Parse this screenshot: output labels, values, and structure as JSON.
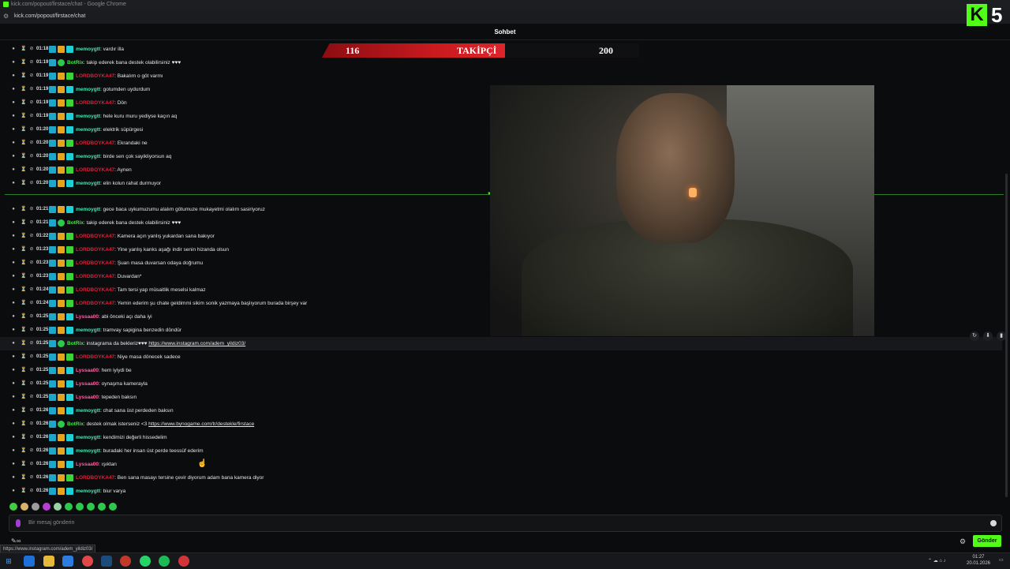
{
  "browser": {
    "title": "kick.com/popout/firstace/chat - Google Chrome",
    "url": "kick.com/popout/firstace/chat"
  },
  "header": {
    "title": "Sohbet",
    "brand_badge": "K",
    "brand_number": "5"
  },
  "follower_goal": {
    "current": "116",
    "label": "TAKİPÇİ",
    "target": "200",
    "progress": 0.58
  },
  "messages": [
    {
      "time": "01:18",
      "user": "memoygtt",
      "text": ": vardır illa",
      "ucls": "u-memo",
      "badges": [
        "b-blue",
        "b-gold",
        "b-cyan"
      ]
    },
    {
      "time": "01:19",
      "user": "BotRix",
      "text": ": takip ederek bana destek olabilirsiniz ♥♥♥",
      "ucls": "u-bot",
      "badges": [
        "b-blue",
        "b-green"
      ]
    },
    {
      "time": "01:19",
      "user": "LORDBOYKA47",
      "text": ": Bakalım o göt varmı",
      "ucls": "u-lord",
      "badges": [
        "b-blue",
        "b-gold",
        "b-lime"
      ]
    },
    {
      "time": "01:19",
      "user": "memoygtt",
      "text": ": gotumden uydurdum",
      "ucls": "u-memo",
      "badges": [
        "b-blue",
        "b-gold",
        "b-cyan"
      ]
    },
    {
      "time": "01:19",
      "user": "LORDBOYKA47",
      "text": ": Dön",
      "ucls": "u-lord",
      "badges": [
        "b-blue",
        "b-gold",
        "b-lime"
      ]
    },
    {
      "time": "01:19",
      "user": "memoygtt",
      "text": ": hele kuru muru yediyse kaçın aq",
      "ucls": "u-memo",
      "badges": [
        "b-blue",
        "b-gold",
        "b-cyan"
      ]
    },
    {
      "time": "01:20",
      "user": "memoygtt",
      "text": ": elektrik süpürgesi",
      "ucls": "u-memo",
      "badges": [
        "b-blue",
        "b-gold",
        "b-cyan"
      ]
    },
    {
      "time": "01:20",
      "user": "LORDBOYKA47",
      "text": ": Ekrandaki ne",
      "ucls": "u-lord",
      "badges": [
        "b-blue",
        "b-gold",
        "b-lime"
      ]
    },
    {
      "time": "01:20",
      "user": "memoygtt",
      "text": ": birde sen çok sayikliyorsun aq",
      "ucls": "u-memo",
      "badges": [
        "b-blue",
        "b-gold",
        "b-cyan"
      ]
    },
    {
      "time": "01:20",
      "user": "LORDBOYKA47",
      "text": ": Aynen",
      "ucls": "u-lord",
      "badges": [
        "b-blue",
        "b-gold",
        "b-lime"
      ]
    },
    {
      "time": "01:20",
      "user": "memoygtt",
      "text": ": elin kolun rahat durmuyor",
      "ucls": "u-memo",
      "badges": [
        "b-blue",
        "b-gold",
        "b-cyan"
      ]
    },
    {
      "time": "01:21",
      "user": "memoygtt",
      "text": ": gece baca uykumuzumu alalım götumuze mukayetmi olalım sasiriyoruz",
      "ucls": "u-memo",
      "badges": [
        "b-blue",
        "b-gold",
        "b-cyan"
      ]
    },
    {
      "time": "01:21",
      "user": "BotRix",
      "text": ": takip ederek bana destek olabilirsiniz ♥♥♥",
      "ucls": "u-bot",
      "badges": [
        "b-blue",
        "b-green"
      ]
    },
    {
      "time": "01:22",
      "user": "LORDBOYKA47",
      "text": ": Kamera açın yanlış yukardan sana bakıyor",
      "ucls": "u-lord",
      "badges": [
        "b-blue",
        "b-gold",
        "b-lime"
      ]
    },
    {
      "time": "01:23",
      "user": "LORDBOYKA47",
      "text": ": Yine yanlış kanks aşağı indir senin hizanda olsun",
      "ucls": "u-lord",
      "badges": [
        "b-blue",
        "b-gold",
        "b-lime"
      ]
    },
    {
      "time": "01:23",
      "user": "LORDBOYKA47",
      "text": ": Şuan masa duvarsan odaya doğrumu",
      "ucls": "u-lord",
      "badges": [
        "b-blue",
        "b-gold",
        "b-lime"
      ]
    },
    {
      "time": "01:23",
      "user": "LORDBOYKA47",
      "text": ": Duvardan*",
      "ucls": "u-lord",
      "badges": [
        "b-blue",
        "b-gold",
        "b-lime"
      ]
    },
    {
      "time": "01:24",
      "user": "LORDBOYKA47",
      "text": ": Tam tersi yap müsaitlik meselsi kalmaz",
      "ucls": "u-lord",
      "badges": [
        "b-blue",
        "b-gold",
        "b-lime"
      ]
    },
    {
      "time": "01:24",
      "user": "LORDBOYKA47",
      "text": ": Yemin ederim şu chate geldimmi sikim sonik yazmaya başlıyorum burada birşey var",
      "ucls": "u-lord",
      "badges": [
        "b-blue",
        "b-gold",
        "b-lime"
      ]
    },
    {
      "time": "01:25",
      "user": "Lyssaa00",
      "text": ": abi önceki açı daha iyi",
      "ucls": "u-lys",
      "badges": [
        "b-blue",
        "b-gold",
        "b-cyan"
      ]
    },
    {
      "time": "01:25",
      "user": "memoygtt",
      "text": ": tramvay sapigina benzedin döndür",
      "ucls": "u-memo",
      "badges": [
        "b-blue",
        "b-gold",
        "b-cyan"
      ]
    },
    {
      "time": "01:25",
      "user": "BotRix",
      "text": ": instagrama da bekleriz♥♥♥ ",
      "link": "https://www.instagram.com/adem_yildiz03/",
      "ucls": "u-bot",
      "badges": [
        "b-blue",
        "b-green"
      ],
      "hl": true
    },
    {
      "time": "01:25",
      "user": "LORDBOYKA47",
      "text": ": Niye masa dönecek sadece",
      "ucls": "u-lord",
      "badges": [
        "b-blue",
        "b-gold",
        "b-lime"
      ]
    },
    {
      "time": "01:25",
      "user": "Lyssaa00",
      "text": ": hem iyiydi be",
      "ucls": "u-lys",
      "badges": [
        "b-blue",
        "b-gold",
        "b-cyan"
      ]
    },
    {
      "time": "01:25",
      "user": "Lyssaa00",
      "text": ": oynaşma kamerayla",
      "ucls": "u-lys",
      "badges": [
        "b-blue",
        "b-gold",
        "b-cyan"
      ]
    },
    {
      "time": "01:25",
      "user": "Lyssaa00",
      "text": ": tepeden baksın",
      "ucls": "u-lys",
      "badges": [
        "b-blue",
        "b-gold",
        "b-cyan"
      ]
    },
    {
      "time": "01:26",
      "user": "memoygtt",
      "text": ": chat sana üst perdeden baksın",
      "ucls": "u-memo",
      "badges": [
        "b-blue",
        "b-gold",
        "b-cyan"
      ]
    },
    {
      "time": "01:26",
      "user": "BotRix",
      "text": ": destek olmak isterseniz <3 ",
      "link": "https://www.bynogame.com/tr/destekle/firstace",
      "ucls": "u-bot",
      "badges": [
        "b-blue",
        "b-green"
      ]
    },
    {
      "time": "01:26",
      "user": "memoygtt",
      "text": ": kendimizi değerli hissedelim",
      "ucls": "u-memo",
      "badges": [
        "b-blue",
        "b-gold",
        "b-cyan"
      ]
    },
    {
      "time": "01:26",
      "user": "memoygtt",
      "text": ": buradaki her insan üst perde teessüf ederim",
      "ucls": "u-memo",
      "badges": [
        "b-blue",
        "b-gold",
        "b-cyan"
      ]
    },
    {
      "time": "01:26",
      "user": "Lyssaa00",
      "text": ": ışıktan",
      "ucls": "u-lys",
      "badges": [
        "b-blue",
        "b-gold",
        "b-cyan"
      ]
    },
    {
      "time": "01:26",
      "user": "LORDBOYKA47",
      "text": ": Ben sana masayı tersine çevir diyorum adam bana kamera diyor",
      "ucls": "u-lord",
      "badges": [
        "b-blue",
        "b-gold",
        "b-lime"
      ]
    },
    {
      "time": "01:26",
      "user": "memoygtt",
      "text": ": biur varya",
      "ucls": "u-memo",
      "badges": [
        "b-blue",
        "b-gold",
        "b-cyan"
      ]
    }
  ],
  "input": {
    "placeholder": "Bir mesaj gönderin"
  },
  "footer": {
    "settings_icon": "gear-icon",
    "send_label": "Gönder",
    "status_url": "https://www.instagram.com/adem_yildiz03/"
  },
  "taskbar": {
    "time": "01:27",
    "date": "20.01.2026"
  }
}
